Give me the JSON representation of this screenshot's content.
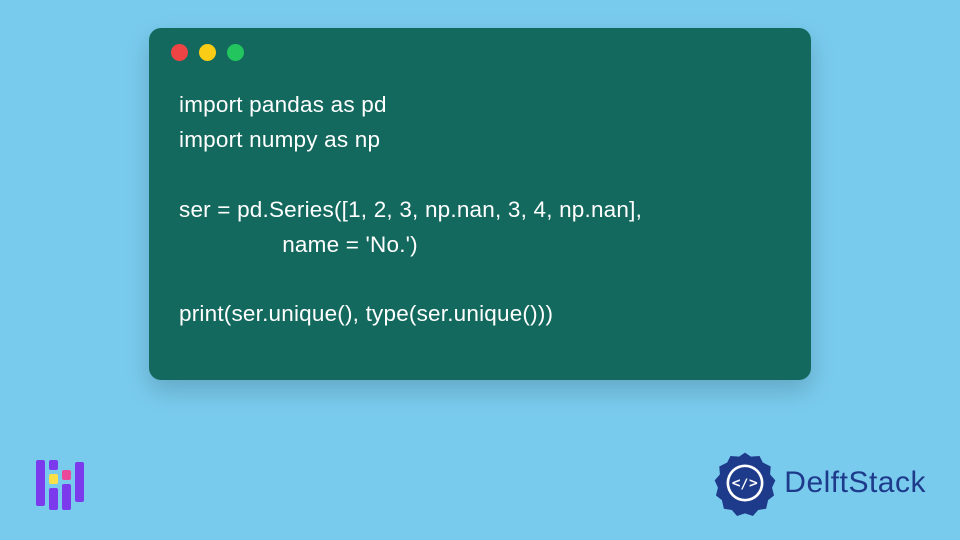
{
  "code": {
    "line1": "import pandas as pd",
    "line2": "import numpy as np",
    "line3": "",
    "line4": "ser = pd.Series([1, 2, 3, np.nan, 3, 4, np.nan],",
    "line5": "                name = 'No.')",
    "line6": "",
    "line7": "print(ser.unique(), type(ser.unique()))"
  },
  "brand": {
    "name": "DelftStack"
  },
  "colors": {
    "background": "#79cbee",
    "window": "#14695e",
    "brand_text": "#1e3a8a"
  }
}
